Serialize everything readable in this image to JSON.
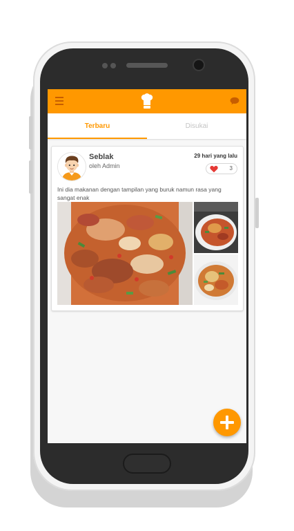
{
  "app": {
    "icons": {
      "menu": "hamburger-menu-icon",
      "logo": "chef-hat-icon",
      "chat": "chat-bubble-icon",
      "like": "heart-icon",
      "add": "plus-icon"
    },
    "colors": {
      "accent": "#ff9800",
      "heart": "#e53935"
    }
  },
  "tabs": [
    {
      "label": "Terbaru",
      "active": true
    },
    {
      "label": "Disukai",
      "active": false
    }
  ],
  "post": {
    "title": "Seblak",
    "author": "oleh Admin",
    "time": "29 hari yang lalu",
    "likes": "3",
    "description": "Ini dia makanan dengan tampilan yang buruk namun rasa yang sangat enak"
  }
}
